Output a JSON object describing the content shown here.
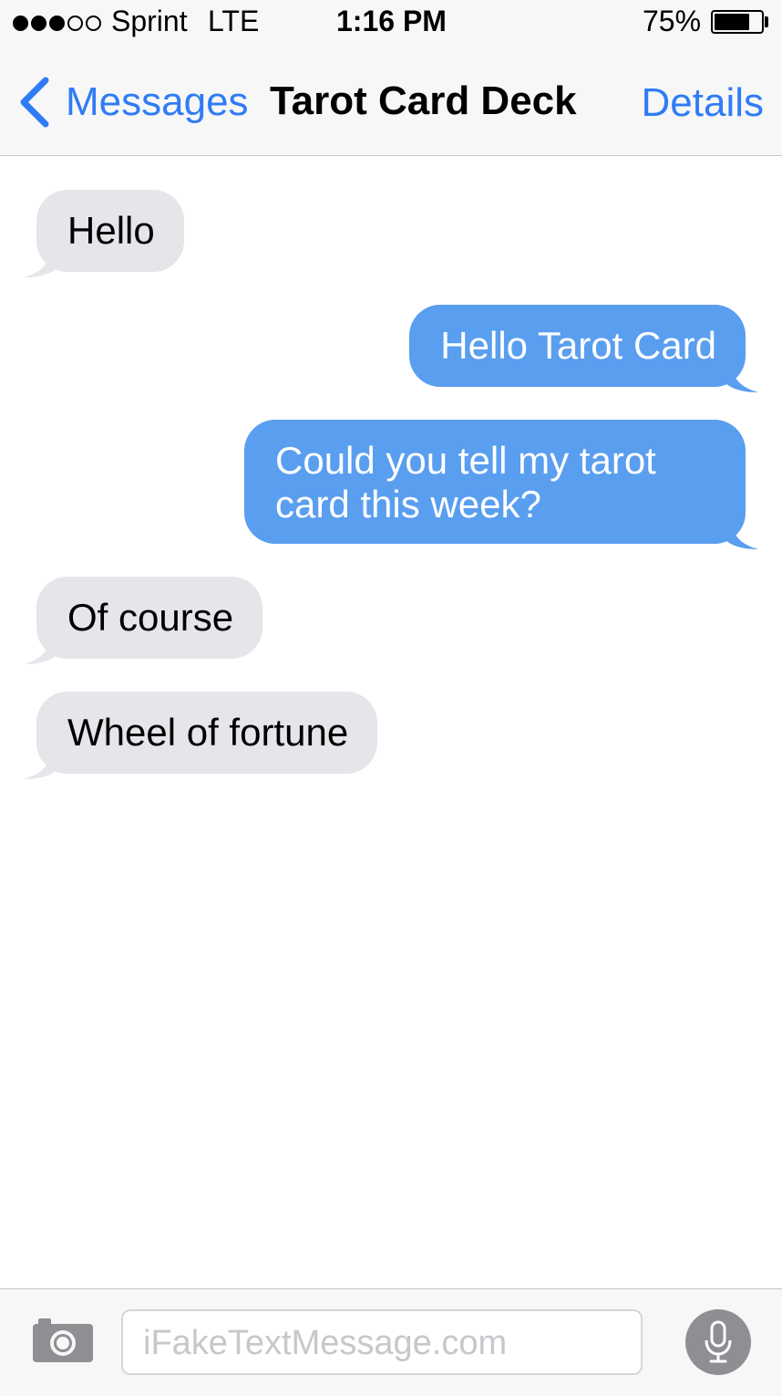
{
  "status": {
    "carrier": "Sprint",
    "network": "LTE",
    "time": "1:16 PM",
    "battery": "75%",
    "battery_level": 0.75,
    "signal_bars": 3,
    "signal_total": 5
  },
  "nav": {
    "back_label": "Messages",
    "title": "Tarot Card Deck",
    "details_label": "Details"
  },
  "messages": [
    {
      "direction": "in",
      "text": "Hello"
    },
    {
      "direction": "out",
      "text": "Hello Tarot Card"
    },
    {
      "direction": "out",
      "text": "Could you tell my tarot card this week?"
    },
    {
      "direction": "in",
      "text": "Of course"
    },
    {
      "direction": "in",
      "text": "Wheel of fortune"
    }
  ],
  "input": {
    "placeholder": "iFakeTextMessage.com",
    "camera_icon": "camera-icon",
    "mic_icon": "microphone-icon"
  },
  "colors": {
    "accent": "#2f7cf6",
    "outgoing_bubble": "#5a9ef0",
    "incoming_bubble": "#e5e5ea"
  }
}
